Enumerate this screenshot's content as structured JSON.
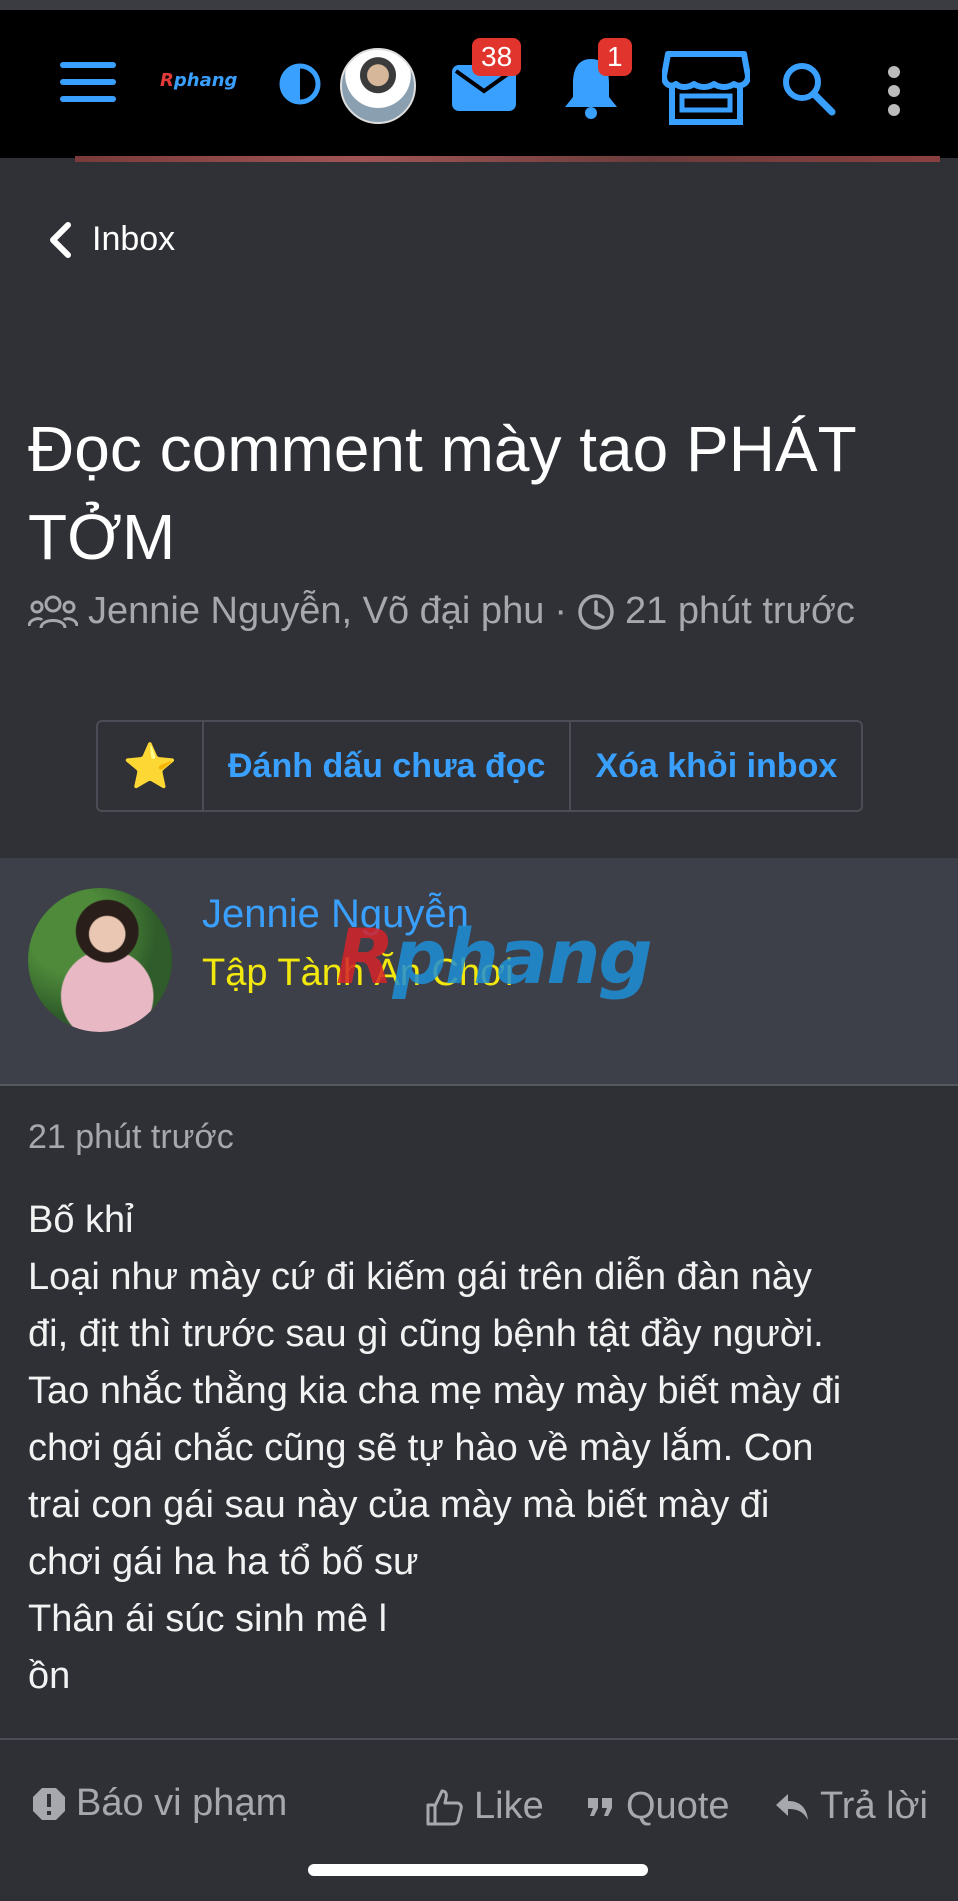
{
  "header": {
    "logo": "Rphang",
    "messages_badge": "38",
    "alerts_badge": "1"
  },
  "nav": {
    "back_label": "Inbox"
  },
  "conversation": {
    "title": "Đọc comment mày tao PHÁT TỞM",
    "participants": "Jennie Nguyễn, Võ đại phu",
    "separator": "·",
    "time": "21 phút trước"
  },
  "actions": {
    "star": "⭐",
    "mark_unread": "Đánh dấu chưa đọc",
    "remove_inbox": "Xóa khỏi inbox"
  },
  "post": {
    "author": "Jennie Nguyễn",
    "user_title": "Tập Tành Ăn Chơi",
    "watermark": "phang",
    "watermark_r": "R",
    "time": "21 phút trước",
    "lines": [
      "Bố khỉ",
      "Loại như mày cứ đi kiếm gái trên diễn đàn này",
      "đi, địt thì trước sau gì cũng bệnh tật đầy người.",
      "Tao nhắc thằng kia cha mẹ mày mày biết mày đi",
      "chơi gái chắc cũng sẽ tự hào về mày lắm. Con",
      "trai con gái sau này của mày mà biết mày đi",
      "chơi gái ha ha tổ bố sư",
      "Thân ái súc sinh mê l",
      "ồn"
    ]
  },
  "footer": {
    "report": "Báo vi phạm",
    "like": "Like",
    "quote": "Quote",
    "reply": "Trả lời"
  },
  "colors": {
    "accent": "#3aa0ff",
    "badge": "#e0342d",
    "user_title": "#f2e80d"
  }
}
